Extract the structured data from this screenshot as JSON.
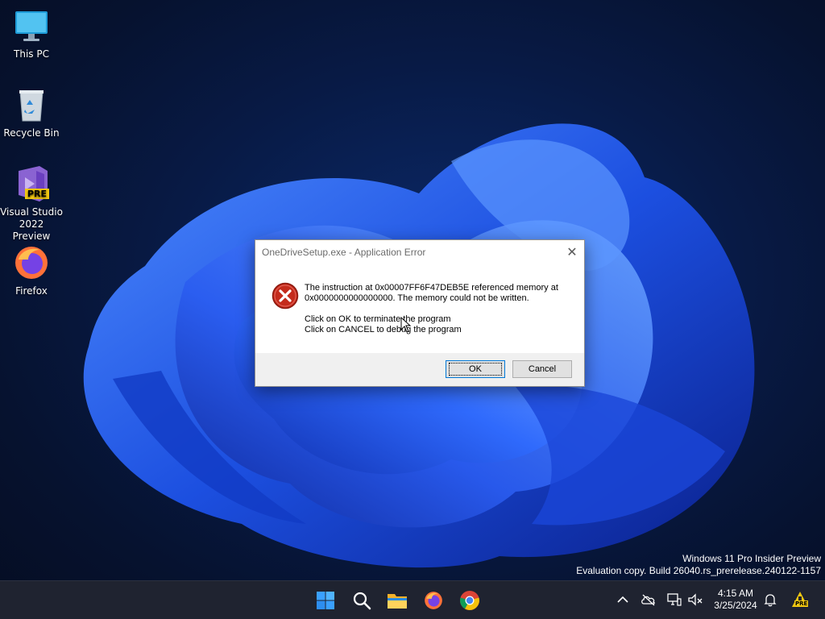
{
  "desktop": {
    "icons": [
      {
        "label": "This PC",
        "icon": "monitor-icon"
      },
      {
        "label": "Recycle Bin",
        "icon": "recycle-bin-icon"
      },
      {
        "label": "Visual Studio 2022 Preview",
        "icon": "visual-studio-icon",
        "badge": "PRE"
      },
      {
        "label": "Firefox",
        "icon": "firefox-icon"
      }
    ]
  },
  "dialog": {
    "title": "OneDriveSetup.exe - Application Error",
    "close_glyph": "✕",
    "icon": "error-icon",
    "message_line1": "The instruction at 0x00007FF6F47DEB5E referenced memory at",
    "message_line2": "0x0000000000000000. The memory could not be written.",
    "message_line3": "Click on OK to terminate the program",
    "message_line4": "Click on CANCEL to debug the program",
    "ok_label": "OK",
    "cancel_label": "Cancel"
  },
  "watermark": {
    "line1": "Windows 11 Pro Insider Preview",
    "line2": "Evaluation copy. Build 26040.rs_prerelease.240122-1157"
  },
  "taskbar": {
    "pinned": [
      "start-icon",
      "search-icon",
      "file-explorer-icon",
      "firefox-icon",
      "chrome-icon"
    ],
    "tray": [
      "chevron-up-icon",
      "onedrive-offline-icon",
      "network-icon",
      "speaker-muted-icon",
      "notification-bell-icon",
      "insider-pre-icon"
    ],
    "time": "4:15 AM",
    "date": "3/25/2024",
    "tray_badge": "PRE"
  },
  "colors": {
    "taskbar": "#1f2330",
    "error_red": "#c42b1c",
    "accent": "#0078d7"
  }
}
